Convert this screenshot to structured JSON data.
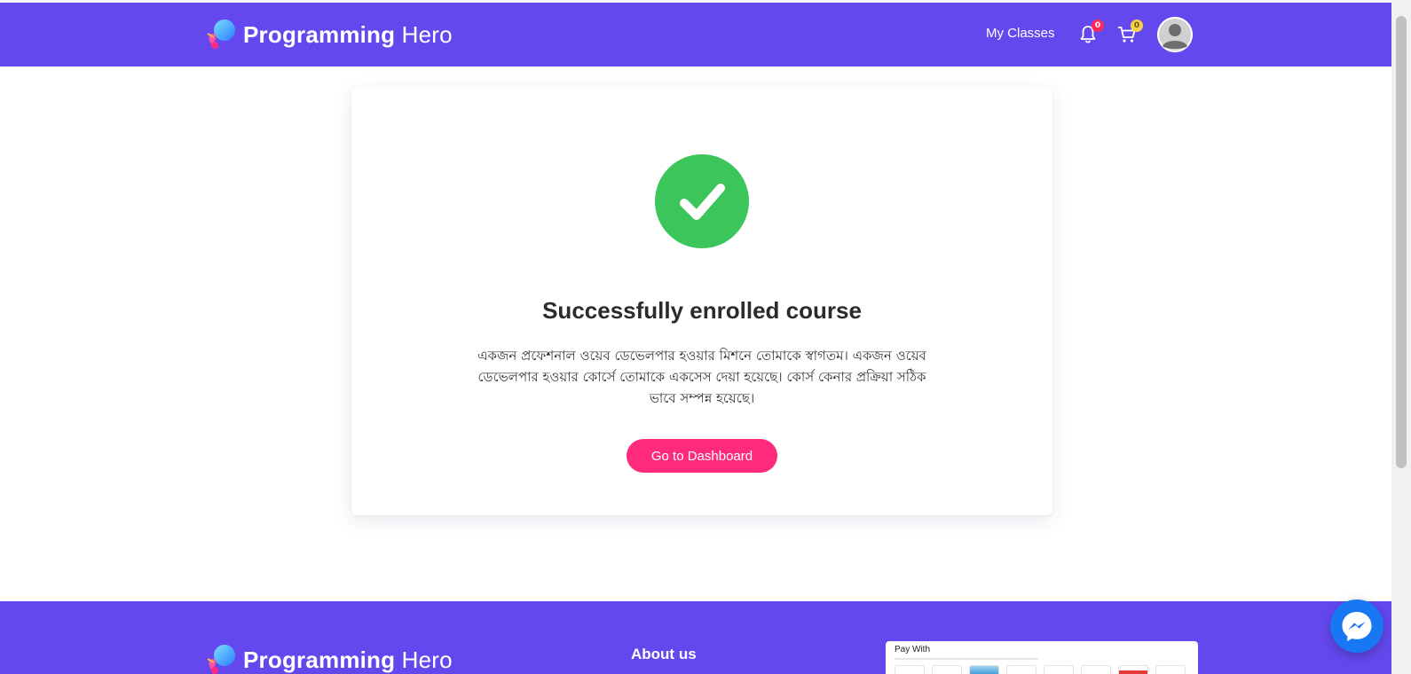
{
  "header": {
    "brand": {
      "bold": "Programming",
      "light": "Hero"
    },
    "nav": {
      "my_classes": "My Classes"
    },
    "notifications": {
      "icon": "bell-icon",
      "count": "0"
    },
    "cart": {
      "icon": "cart-icon",
      "count": "0"
    },
    "avatar": {
      "icon": "user-avatar-icon"
    }
  },
  "card": {
    "status_icon": "check-circle-icon",
    "title": "Successfully enrolled course",
    "message": "একজন প্রফেশনাল ওয়েব ডেভেলপার হওয়ার মিশনে তোমাকে স্বাগতম। একজন ওয়েব ডেভেলপার হওয়ার কোর্সে তোমাকে একসেস দেয়া হয়েছে। কোর্স কেনার প্রক্রিয়া সঠিক ভাবে সম্পন্ন হয়েছে।",
    "button_label": "Go to Dashboard"
  },
  "footer": {
    "brand": {
      "bold": "Programming",
      "light": "Hero"
    },
    "about_heading": "About us",
    "payment": {
      "label": "Pay With"
    }
  },
  "messenger": {
    "icon": "messenger-icon"
  },
  "colors": {
    "brand_purple": "#6448ee",
    "success_green": "#3bc55a",
    "cta_pink": "#ff2a7c",
    "badge_red": "#ff2a5a",
    "badge_yellow": "#f4d24a",
    "messenger_blue": "#1877f2"
  }
}
